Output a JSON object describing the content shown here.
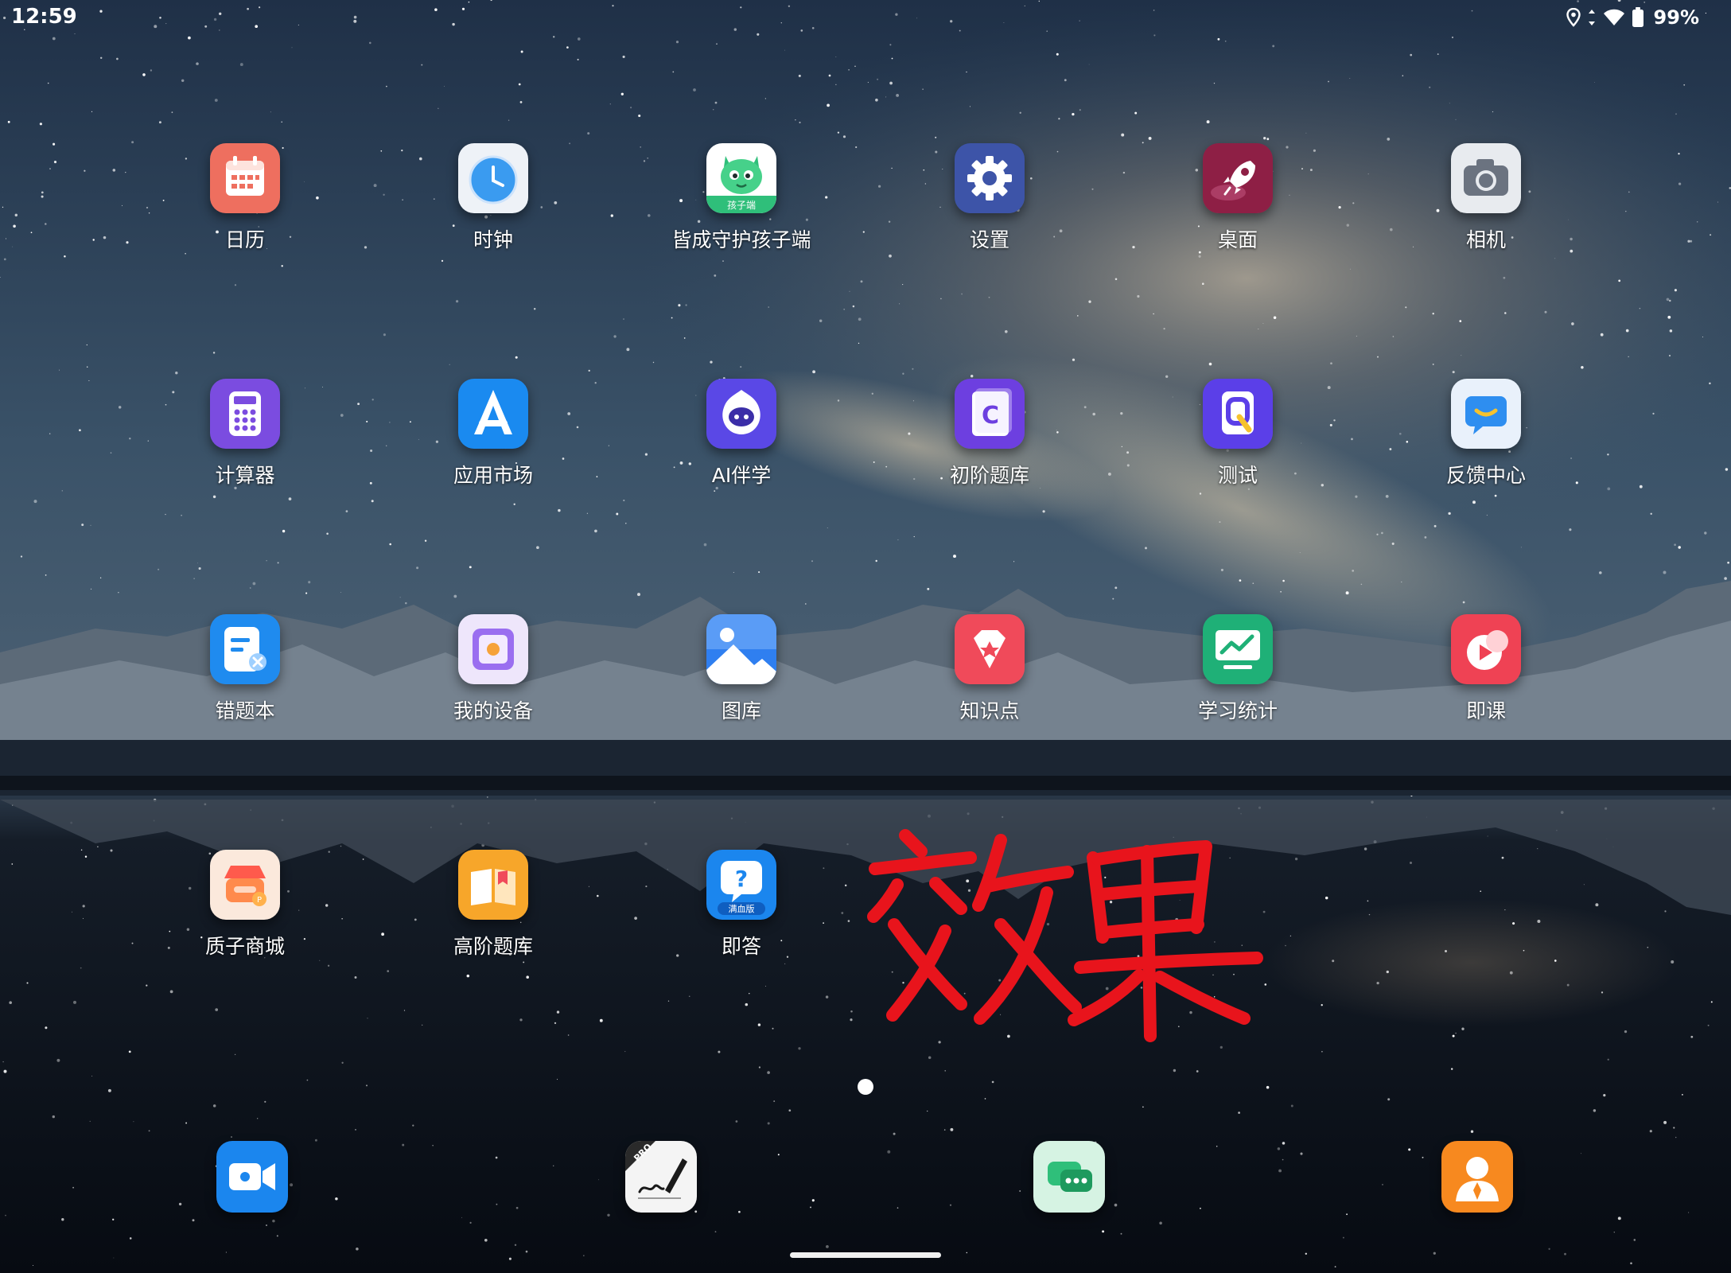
{
  "status_bar": {
    "time": "12:59",
    "battery_percent": "99%",
    "icons": [
      "location-icon",
      "signal-arrows-icon",
      "wifi-icon",
      "battery-icon"
    ]
  },
  "apps": [
    {
      "label": "日历",
      "icon": "calendar-icon"
    },
    {
      "label": "时钟",
      "icon": "clock-icon"
    },
    {
      "label": "皆成守护孩子端",
      "icon": "dragon-mascot-icon",
      "badge": "孩子端"
    },
    {
      "label": "设置",
      "icon": "gear-icon"
    },
    {
      "label": "桌面",
      "icon": "rocket-icon"
    },
    {
      "label": "相机",
      "icon": "camera-icon"
    },
    {
      "label": "计算器",
      "icon": "calculator-icon"
    },
    {
      "label": "应用市场",
      "icon": "app-store-icon"
    },
    {
      "label": "AI伴学",
      "icon": "ai-mascot-icon"
    },
    {
      "label": "初阶题库",
      "icon": "question-bank-c-icon"
    },
    {
      "label": "测试",
      "icon": "quiz-q-icon"
    },
    {
      "label": "反馈中心",
      "icon": "feedback-chat-icon"
    },
    {
      "label": "错题本",
      "icon": "mistake-note-icon"
    },
    {
      "label": "我的设备",
      "icon": "device-icon"
    },
    {
      "label": "图库",
      "icon": "gallery-icon"
    },
    {
      "label": "知识点",
      "icon": "knowledge-gem-icon"
    },
    {
      "label": "学习统计",
      "icon": "statistics-chart-icon"
    },
    {
      "label": "即课",
      "icon": "video-lesson-icon"
    },
    {
      "label": "质子商城",
      "icon": "shop-icon"
    },
    {
      "label": "高阶题库",
      "icon": "advanced-book-icon"
    },
    {
      "label": "即答",
      "icon": "instant-answer-icon",
      "badge": "满血版"
    }
  ],
  "dock": [
    {
      "icon": "video-meeting-icon"
    },
    {
      "icon": "signature-pen-icon",
      "badge": "PRO"
    },
    {
      "icon": "chat-bubbles-icon"
    },
    {
      "icon": "contacts-person-icon"
    }
  ],
  "handwriting_icon": "handwritten-效果-annotation",
  "colors": {
    "handwriting": "#e8141c",
    "calendar": "#ee6f5f",
    "settings": "#3d54a8",
    "desktop": "#8e1f45",
    "calculator": "#7b4ce0",
    "app_store": "#1a8af0"
  }
}
